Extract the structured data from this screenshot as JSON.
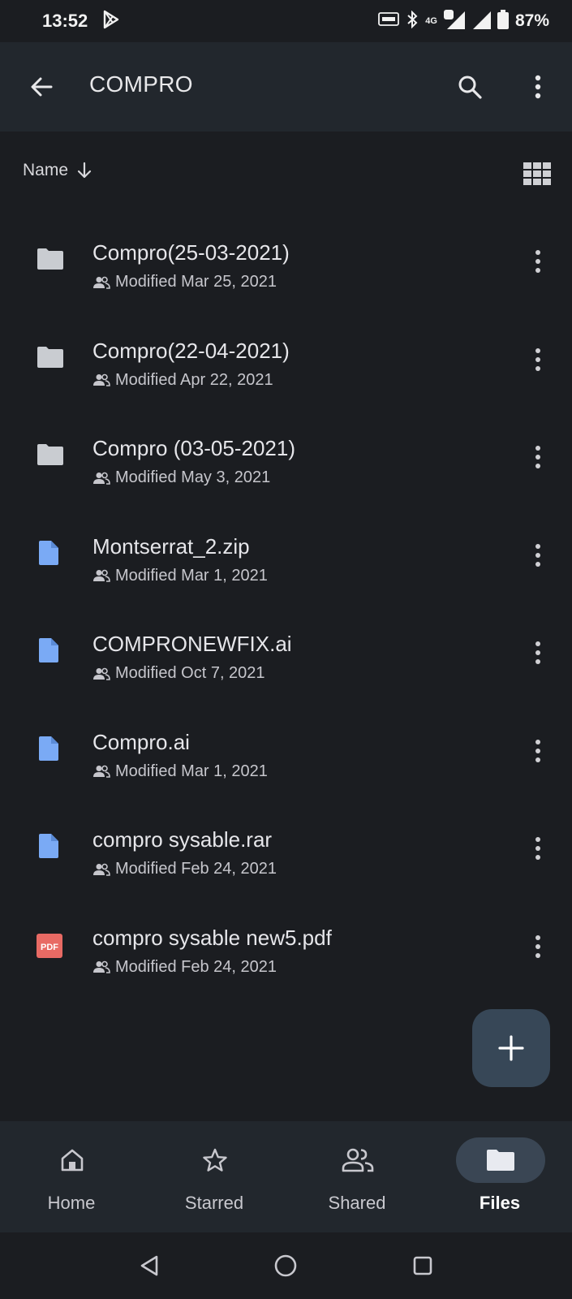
{
  "status_bar": {
    "time": "13:52",
    "network": "4G",
    "battery": "87%"
  },
  "app_bar": {
    "title": "COMPRO",
    "icons": [
      "back-arrow-icon",
      "search-icon",
      "more-vert-icon"
    ]
  },
  "sort": {
    "label": "Name"
  },
  "files": [
    {
      "name": "Compro(25-03-2021)",
      "meta": "Modified Mar 25, 2021",
      "type": "folder"
    },
    {
      "name": "Compro(22-04-2021)",
      "meta": "Modified Apr 22, 2021",
      "type": "folder"
    },
    {
      "name": "Compro (03-05-2021)",
      "meta": "Modified May 3, 2021",
      "type": "folder"
    },
    {
      "name": "Montserrat_2.zip",
      "meta": "Modified Mar 1, 2021",
      "type": "file"
    },
    {
      "name": "COMPRONEWFIX.ai",
      "meta": "Modified Oct 7, 2021",
      "type": "file"
    },
    {
      "name": "Compro.ai",
      "meta": "Modified Mar 1, 2021",
      "type": "file"
    },
    {
      "name": "compro sysable.rar",
      "meta": "Modified Feb 24, 2021",
      "type": "file"
    },
    {
      "name": "compro sysable new5.pdf",
      "meta": "Modified Feb 24, 2021",
      "type": "pdf"
    }
  ],
  "pdf_badge": "PDF",
  "bottom_nav": [
    {
      "label": "Home",
      "icon": "home-icon",
      "active": false
    },
    {
      "label": "Starred",
      "icon": "star-icon",
      "active": false
    },
    {
      "label": "Shared",
      "icon": "shared-people-icon",
      "active": false
    },
    {
      "label": "Files",
      "icon": "folder-icon",
      "active": true
    }
  ],
  "colors": {
    "background": "#1b1d21",
    "app_bar": "#22272d",
    "folder_icon": "#c9ccd1",
    "file_icon": "#7aaaf5",
    "pdf_icon": "#e86a64",
    "fab": "#374757",
    "active_pill": "#3a4654"
  }
}
